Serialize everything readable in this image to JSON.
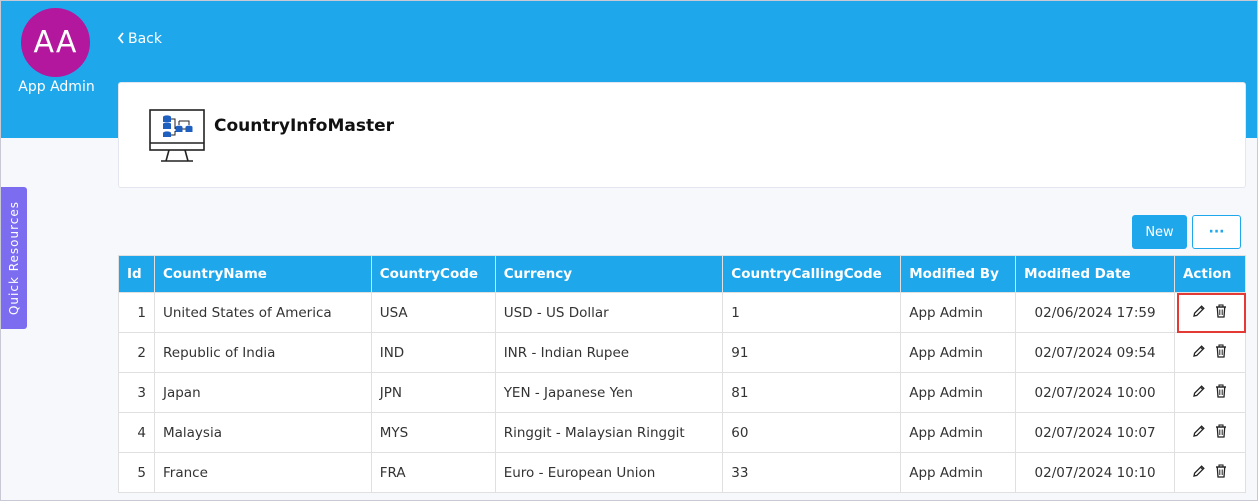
{
  "user": {
    "initials": "AA",
    "name": "App Admin"
  },
  "nav": {
    "back_label": "Back"
  },
  "page": {
    "title": "CountryInfoMaster"
  },
  "sidebar": {
    "quick_resources_label": "Quick Resources"
  },
  "toolbar": {
    "new_label": "New",
    "more_label": "···"
  },
  "table": {
    "columns": [
      "Id",
      "CountryName",
      "CountryCode",
      "Currency",
      "CountryCallingCode",
      "Modified By",
      "Modified Date",
      "Action"
    ],
    "rows": [
      {
        "id": "1",
        "name": "United States of America",
        "code": "USA",
        "currency": "USD - US Dollar",
        "calling": "1",
        "modified_by": "App Admin",
        "modified_date": "02/06/2024 17:59"
      },
      {
        "id": "2",
        "name": "Republic of India",
        "code": "IND",
        "currency": "INR - Indian Rupee",
        "calling": "91",
        "modified_by": "App Admin",
        "modified_date": "02/07/2024 09:54"
      },
      {
        "id": "3",
        "name": "Japan",
        "code": "JPN",
        "currency": "YEN - Japanese Yen",
        "calling": "81",
        "modified_by": "App Admin",
        "modified_date": "02/07/2024 10:00"
      },
      {
        "id": "4",
        "name": "Malaysia",
        "code": "MYS",
        "currency": "Ringgit - Malaysian Ringgit",
        "calling": "60",
        "modified_by": "App Admin",
        "modified_date": "02/07/2024 10:07"
      },
      {
        "id": "5",
        "name": "France",
        "code": "FRA",
        "currency": "Euro - European Union",
        "calling": "33",
        "modified_by": "App Admin",
        "modified_date": "02/07/2024 10:10"
      }
    ]
  },
  "icons": {
    "edit": "pencil-icon",
    "delete": "trash-icon",
    "header": "database-monitor-icon"
  },
  "colors": {
    "primary": "#1fa7ec",
    "avatar": "#b3179d",
    "quick_resources": "#7b6cf0",
    "highlight": "#e53935"
  }
}
